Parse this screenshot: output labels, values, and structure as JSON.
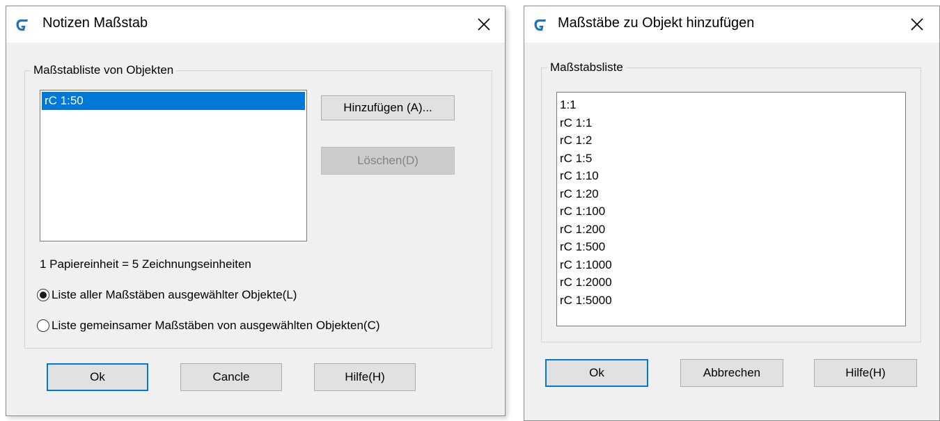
{
  "dialog1": {
    "title": "Notizen Maßstab",
    "close_glyph": "✕",
    "group_label": "Maßstabliste von Objekten",
    "list_items": [
      "rC 1:50"
    ],
    "selected_index": 0,
    "add_button": "Hinzufügen (A)...",
    "delete_button": "Löschen(D)",
    "unit_text": "1 Papiereinheit = 5  Zeichnungseinheiten",
    "radio_all": "Liste aller Maßstäben ausgewählter Objekte(L)",
    "radio_common": "Liste gemeinsamer Maßstäben von ausgewählten Objekten(C)",
    "radio_selected": "all",
    "ok_button": "Ok",
    "cancel_button": "Cancle",
    "help_button": "Hilfe(H)"
  },
  "dialog2": {
    "title": "Maßstäbe zu Objekt hinzufügen",
    "close_glyph": "✕",
    "group_label": "Maßstabsliste",
    "list_items": [
      "1:1",
      "rC 1:1",
      "rC 1:2",
      "rC 1:5",
      "rC 1:10",
      "rC 1:20",
      "rC 1:100",
      "rC 1:200",
      "rC 1:500",
      "rC 1:1000",
      "rC 1:2000",
      "rC 1:5000"
    ],
    "ok_button": "Ok",
    "cancel_button": "Abbrechen",
    "help_button": "Hilfe(H)"
  },
  "colors": {
    "accent": "#0078d7",
    "app_icon": "#1e73be",
    "dialog_bg": "#f0f0f0"
  },
  "icons": {
    "app": "gstarcad-logo-icon",
    "close": "close-icon"
  }
}
